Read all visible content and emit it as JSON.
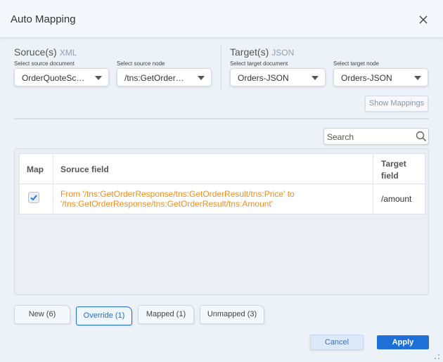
{
  "dialog": {
    "title": "Auto Mapping",
    "close_icon": "close-icon"
  },
  "source": {
    "heading": "Soruce(s)",
    "format": "XML",
    "document_label": "Select source document",
    "document_value": "OrderQuoteSchema",
    "node_label": "Select source node",
    "node_value": "/tns:GetOrderResponse"
  },
  "target": {
    "heading": "Target(s)",
    "format": "JSON",
    "document_label": "Select target document",
    "document_value": "Orders-JSON",
    "node_label": "Select target node",
    "node_value": "Orders-JSON"
  },
  "show_mappings_label": "Show Mappings",
  "search": {
    "placeholder": "Search",
    "icon": "search-icon"
  },
  "table": {
    "columns": {
      "map": "Map",
      "source": "Soruce field",
      "target_line1": "Target",
      "target_line2": "field"
    },
    "rows": [
      {
        "checked": true,
        "source_line1": "From '/tns:GetOrderResponse/tns:GetOrderResult/tns:Price' to",
        "source_line2": "'/tns:GetOrderResponse/tns:GetOrderResult/tns:Amount'",
        "target": "/amount"
      }
    ]
  },
  "tabs": [
    {
      "label": "New (6)",
      "active": false
    },
    {
      "label": "Override (1)",
      "active": true
    },
    {
      "label": "Mapped (1)",
      "active": false
    },
    {
      "label": "Unmapped (3)",
      "active": false
    }
  ],
  "buttons": {
    "cancel": "Cancel",
    "apply": "Apply"
  },
  "colors": {
    "accent": "#1f6fd8",
    "warning_text": "#f08c1e"
  }
}
